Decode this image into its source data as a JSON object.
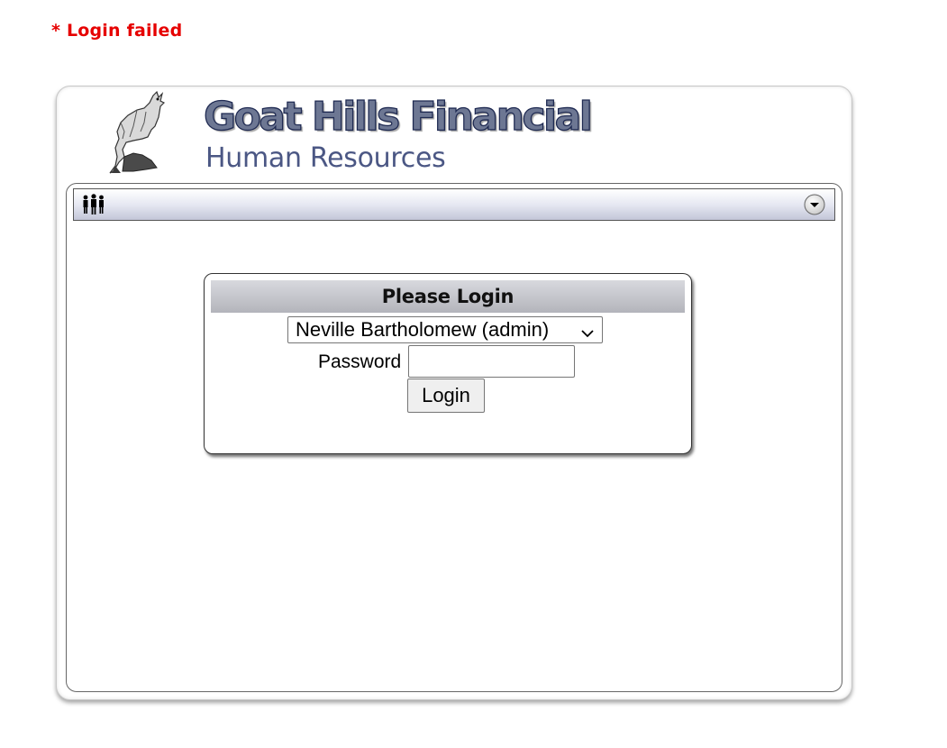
{
  "error": {
    "message": "* Login failed",
    "color": "#e60000"
  },
  "header": {
    "title": "Goat Hills Financial",
    "subtitle": "Human Resources",
    "logo_icon": "goat-icon"
  },
  "nav": {
    "left_icon": "people-icon",
    "right_icon": "dropdown-arrow-icon"
  },
  "login": {
    "heading": "Please Login",
    "user_select": {
      "selected": "Neville Bartholomew (admin)"
    },
    "password_label": "Password",
    "password_value": "",
    "button_label": "Login"
  },
  "colors": {
    "brand_fill": "#6d7793",
    "brand_outline": "#1f2a52",
    "subtitle": "#4b5784",
    "header_bar": "#b3b4bb"
  }
}
